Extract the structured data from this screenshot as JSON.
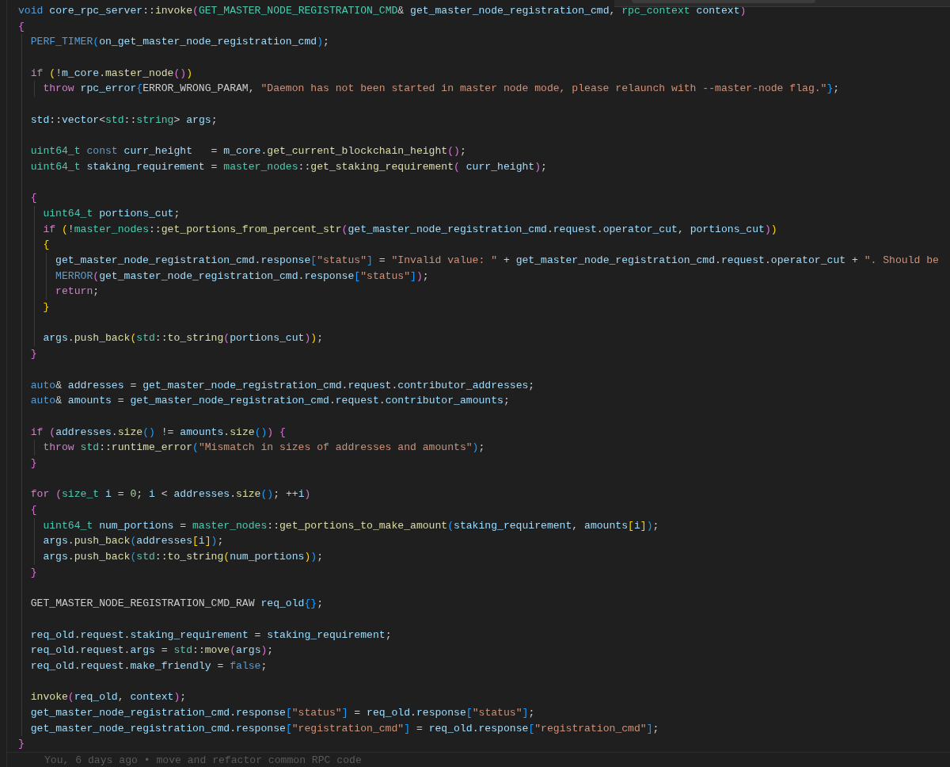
{
  "editor": {
    "lines": [
      {
        "kind": "code",
        "tokens": [
          {
            "kind": "st",
            "text": "void "
          },
          {
            "kind": "v",
            "text": "core_rpc_server"
          },
          {
            "kind": "p",
            "text": "::"
          },
          {
            "kind": "fn",
            "text": "invoke"
          },
          {
            "kind": "b2",
            "text": "("
          },
          {
            "kind": "ty",
            "text": "GET_MASTER_NODE_REGISTRATION_CMD"
          },
          {
            "kind": "p",
            "text": "& "
          },
          {
            "kind": "v",
            "text": "get_master_node_registration_cmd"
          },
          {
            "kind": "p",
            "text": ", "
          },
          {
            "kind": "ty",
            "text": "rpc_context "
          },
          {
            "kind": "v",
            "text": "context"
          },
          {
            "kind": "b2",
            "text": ")"
          }
        ]
      },
      {
        "kind": "code",
        "tokens": [
          {
            "kind": "b2",
            "text": "{"
          }
        ]
      },
      {
        "kind": "code",
        "tokens": [
          {
            "kind": "st",
            "text": "  PERF_TIMER"
          },
          {
            "kind": "b3",
            "text": "("
          },
          {
            "kind": "v",
            "text": "on_get_master_node_registration_cmd"
          },
          {
            "kind": "b3",
            "text": ")"
          },
          {
            "kind": "p",
            "text": ";"
          }
        ]
      },
      {
        "kind": "blank"
      },
      {
        "kind": "code",
        "tokens": [
          {
            "kind": "kw",
            "text": "  if "
          },
          {
            "kind": "b1",
            "text": "("
          },
          {
            "kind": "p",
            "text": "!"
          },
          {
            "kind": "v",
            "text": "m_core"
          },
          {
            "kind": "p",
            "text": "."
          },
          {
            "kind": "fn",
            "text": "master_node"
          },
          {
            "kind": "b2",
            "text": "()"
          },
          {
            "kind": "b1",
            "text": ")"
          }
        ]
      },
      {
        "kind": "code",
        "tokens": [
          {
            "kind": "kw",
            "text": "    throw "
          },
          {
            "kind": "v",
            "text": "rpc_error"
          },
          {
            "kind": "b3",
            "text": "{"
          },
          {
            "kind": "p",
            "text": "ERROR_WRONG_PARAM, "
          },
          {
            "kind": "s",
            "text": "\"Daemon has not been started in master node mode, please relaunch with --master-node flag.\""
          },
          {
            "kind": "b3",
            "text": "}"
          },
          {
            "kind": "p",
            "text": ";"
          }
        ]
      },
      {
        "kind": "blank"
      },
      {
        "kind": "code",
        "tokens": [
          {
            "kind": "v",
            "text": "  std"
          },
          {
            "kind": "p",
            "text": "::"
          },
          {
            "kind": "v",
            "text": "vector"
          },
          {
            "kind": "p",
            "text": "<"
          },
          {
            "kind": "ty",
            "text": "std"
          },
          {
            "kind": "p",
            "text": "::"
          },
          {
            "kind": "ty",
            "text": "string"
          },
          {
            "kind": "p",
            "text": "> "
          },
          {
            "kind": "v",
            "text": "args"
          },
          {
            "kind": "p",
            "text": ";"
          }
        ]
      },
      {
        "kind": "blank"
      },
      {
        "kind": "code",
        "tokens": [
          {
            "kind": "ty",
            "text": "  uint64_t "
          },
          {
            "kind": "st",
            "text": "const "
          },
          {
            "kind": "v",
            "text": "curr_height"
          },
          {
            "kind": "p",
            "text": "   = "
          },
          {
            "kind": "v",
            "text": "m_core"
          },
          {
            "kind": "p",
            "text": "."
          },
          {
            "kind": "fn",
            "text": "get_current_blockchain_height"
          },
          {
            "kind": "b2",
            "text": "()"
          },
          {
            "kind": "p",
            "text": ";"
          }
        ]
      },
      {
        "kind": "code",
        "tokens": [
          {
            "kind": "ty",
            "text": "  uint64_t "
          },
          {
            "kind": "v",
            "text": "staking_requirement"
          },
          {
            "kind": "p",
            "text": " = "
          },
          {
            "kind": "ty",
            "text": "master_nodes"
          },
          {
            "kind": "p",
            "text": "::"
          },
          {
            "kind": "fn",
            "text": "get_staking_requirement"
          },
          {
            "kind": "b2",
            "text": "( "
          },
          {
            "kind": "v",
            "text": "curr_height"
          },
          {
            "kind": "b2",
            "text": ")"
          },
          {
            "kind": "p",
            "text": ";"
          }
        ]
      },
      {
        "kind": "blank"
      },
      {
        "kind": "code",
        "tokens": [
          {
            "kind": "b2",
            "text": "  {"
          }
        ]
      },
      {
        "kind": "code",
        "tokens": [
          {
            "kind": "ty",
            "text": "    uint64_t "
          },
          {
            "kind": "v",
            "text": "portions_cut"
          },
          {
            "kind": "p",
            "text": ";"
          }
        ]
      },
      {
        "kind": "code",
        "tokens": [
          {
            "kind": "kw",
            "text": "    if "
          },
          {
            "kind": "b1",
            "text": "("
          },
          {
            "kind": "p",
            "text": "!"
          },
          {
            "kind": "ty",
            "text": "master_nodes"
          },
          {
            "kind": "p",
            "text": "::"
          },
          {
            "kind": "fn",
            "text": "get_portions_from_percent_str"
          },
          {
            "kind": "b2",
            "text": "("
          },
          {
            "kind": "v",
            "text": "get_master_node_registration_cmd"
          },
          {
            "kind": "p",
            "text": "."
          },
          {
            "kind": "v",
            "text": "request"
          },
          {
            "kind": "p",
            "text": "."
          },
          {
            "kind": "v",
            "text": "operator_cut"
          },
          {
            "kind": "p",
            "text": ", "
          },
          {
            "kind": "v",
            "text": "portions_cut"
          },
          {
            "kind": "b2",
            "text": ")"
          },
          {
            "kind": "b1",
            "text": ")"
          }
        ]
      },
      {
        "kind": "code",
        "tokens": [
          {
            "kind": "b1",
            "text": "    {"
          }
        ]
      },
      {
        "kind": "code",
        "tokens": [
          {
            "kind": "v",
            "text": "      get_master_node_registration_cmd"
          },
          {
            "kind": "p",
            "text": "."
          },
          {
            "kind": "v",
            "text": "response"
          },
          {
            "kind": "b3",
            "text": "["
          },
          {
            "kind": "s",
            "text": "\"status\""
          },
          {
            "kind": "b3",
            "text": "]"
          },
          {
            "kind": "p",
            "text": " = "
          },
          {
            "kind": "s",
            "text": "\"Invalid value: \""
          },
          {
            "kind": "p",
            "text": " + "
          },
          {
            "kind": "v",
            "text": "get_master_node_registration_cmd"
          },
          {
            "kind": "p",
            "text": "."
          },
          {
            "kind": "v",
            "text": "request"
          },
          {
            "kind": "p",
            "text": "."
          },
          {
            "kind": "v",
            "text": "operator_cut"
          },
          {
            "kind": "p",
            "text": " + "
          },
          {
            "kind": "s",
            "text": "\". Should be"
          }
        ]
      },
      {
        "kind": "code",
        "tokens": [
          {
            "kind": "st",
            "text": "      MERROR"
          },
          {
            "kind": "b2",
            "text": "("
          },
          {
            "kind": "v",
            "text": "get_master_node_registration_cmd"
          },
          {
            "kind": "p",
            "text": "."
          },
          {
            "kind": "v",
            "text": "response"
          },
          {
            "kind": "b3",
            "text": "["
          },
          {
            "kind": "s",
            "text": "\"status\""
          },
          {
            "kind": "b3",
            "text": "]"
          },
          {
            "kind": "b2",
            "text": ")"
          },
          {
            "kind": "p",
            "text": ";"
          }
        ]
      },
      {
        "kind": "code",
        "tokens": [
          {
            "kind": "kw",
            "text": "      return"
          },
          {
            "kind": "p",
            "text": ";"
          }
        ]
      },
      {
        "kind": "code",
        "tokens": [
          {
            "kind": "b1",
            "text": "    }"
          }
        ]
      },
      {
        "kind": "blank"
      },
      {
        "kind": "code",
        "tokens": [
          {
            "kind": "v",
            "text": "    args"
          },
          {
            "kind": "p",
            "text": "."
          },
          {
            "kind": "fn",
            "text": "push_back"
          },
          {
            "kind": "b1",
            "text": "("
          },
          {
            "kind": "ty",
            "text": "std"
          },
          {
            "kind": "p",
            "text": "::"
          },
          {
            "kind": "fn",
            "text": "to_string"
          },
          {
            "kind": "b2",
            "text": "("
          },
          {
            "kind": "v",
            "text": "portions_cut"
          },
          {
            "kind": "b2",
            "text": ")"
          },
          {
            "kind": "b1",
            "text": ")"
          },
          {
            "kind": "p",
            "text": ";"
          }
        ]
      },
      {
        "kind": "code",
        "tokens": [
          {
            "kind": "b2",
            "text": "  }"
          }
        ]
      },
      {
        "kind": "blank"
      },
      {
        "kind": "code",
        "tokens": [
          {
            "kind": "st",
            "text": "  auto"
          },
          {
            "kind": "p",
            "text": "& "
          },
          {
            "kind": "v",
            "text": "addresses"
          },
          {
            "kind": "p",
            "text": " = "
          },
          {
            "kind": "v",
            "text": "get_master_node_registration_cmd"
          },
          {
            "kind": "p",
            "text": "."
          },
          {
            "kind": "v",
            "text": "request"
          },
          {
            "kind": "p",
            "text": "."
          },
          {
            "kind": "v",
            "text": "contributor_addresses"
          },
          {
            "kind": "p",
            "text": ";"
          }
        ]
      },
      {
        "kind": "code",
        "tokens": [
          {
            "kind": "st",
            "text": "  auto"
          },
          {
            "kind": "p",
            "text": "& "
          },
          {
            "kind": "v",
            "text": "amounts"
          },
          {
            "kind": "p",
            "text": " = "
          },
          {
            "kind": "v",
            "text": "get_master_node_registration_cmd"
          },
          {
            "kind": "p",
            "text": "."
          },
          {
            "kind": "v",
            "text": "request"
          },
          {
            "kind": "p",
            "text": "."
          },
          {
            "kind": "v",
            "text": "contributor_amounts"
          },
          {
            "kind": "p",
            "text": ";"
          }
        ]
      },
      {
        "kind": "blank"
      },
      {
        "kind": "code",
        "tokens": [
          {
            "kind": "kw",
            "text": "  if "
          },
          {
            "kind": "b2",
            "text": "("
          },
          {
            "kind": "v",
            "text": "addresses"
          },
          {
            "kind": "p",
            "text": "."
          },
          {
            "kind": "fn",
            "text": "size"
          },
          {
            "kind": "b3",
            "text": "()"
          },
          {
            "kind": "p",
            "text": " != "
          },
          {
            "kind": "v",
            "text": "amounts"
          },
          {
            "kind": "p",
            "text": "."
          },
          {
            "kind": "fn",
            "text": "size"
          },
          {
            "kind": "b3",
            "text": "()"
          },
          {
            "kind": "b2",
            "text": ")"
          },
          {
            "kind": "b2",
            "text": " {"
          }
        ]
      },
      {
        "kind": "code",
        "tokens": [
          {
            "kind": "kw",
            "text": "    throw "
          },
          {
            "kind": "ty",
            "text": "std"
          },
          {
            "kind": "p",
            "text": "::"
          },
          {
            "kind": "fn",
            "text": "runtime_error"
          },
          {
            "kind": "b3",
            "text": "("
          },
          {
            "kind": "s",
            "text": "\"Mismatch in sizes of addresses and amounts\""
          },
          {
            "kind": "b3",
            "text": ")"
          },
          {
            "kind": "p",
            "text": ";"
          }
        ]
      },
      {
        "kind": "code",
        "tokens": [
          {
            "kind": "b2",
            "text": "  }"
          }
        ]
      },
      {
        "kind": "blank"
      },
      {
        "kind": "code",
        "tokens": [
          {
            "kind": "kw",
            "text": "  for "
          },
          {
            "kind": "b2",
            "text": "("
          },
          {
            "kind": "ty",
            "text": "size_t "
          },
          {
            "kind": "v",
            "text": "i"
          },
          {
            "kind": "p",
            "text": " = "
          },
          {
            "kind": "n",
            "text": "0"
          },
          {
            "kind": "p",
            "text": "; "
          },
          {
            "kind": "v",
            "text": "i"
          },
          {
            "kind": "p",
            "text": " < "
          },
          {
            "kind": "v",
            "text": "addresses"
          },
          {
            "kind": "p",
            "text": "."
          },
          {
            "kind": "fn",
            "text": "size"
          },
          {
            "kind": "b3",
            "text": "()"
          },
          {
            "kind": "p",
            "text": "; ++"
          },
          {
            "kind": "v",
            "text": "i"
          },
          {
            "kind": "b2",
            "text": ")"
          }
        ]
      },
      {
        "kind": "code",
        "tokens": [
          {
            "kind": "b2",
            "text": "  {"
          }
        ]
      },
      {
        "kind": "code",
        "tokens": [
          {
            "kind": "ty",
            "text": "    uint64_t "
          },
          {
            "kind": "v",
            "text": "num_portions"
          },
          {
            "kind": "p",
            "text": " = "
          },
          {
            "kind": "ty",
            "text": "master_nodes"
          },
          {
            "kind": "p",
            "text": "::"
          },
          {
            "kind": "fn",
            "text": "get_portions_to_make_amount"
          },
          {
            "kind": "b3",
            "text": "("
          },
          {
            "kind": "v",
            "text": "staking_requirement"
          },
          {
            "kind": "p",
            "text": ", "
          },
          {
            "kind": "v",
            "text": "amounts"
          },
          {
            "kind": "b1",
            "text": "["
          },
          {
            "kind": "v",
            "text": "i"
          },
          {
            "kind": "b1",
            "text": "]"
          },
          {
            "kind": "b3",
            "text": ")"
          },
          {
            "kind": "p",
            "text": ";"
          }
        ]
      },
      {
        "kind": "code",
        "tokens": [
          {
            "kind": "v",
            "text": "    args"
          },
          {
            "kind": "p",
            "text": "."
          },
          {
            "kind": "fn",
            "text": "push_back"
          },
          {
            "kind": "b3",
            "text": "("
          },
          {
            "kind": "v",
            "text": "addresses"
          },
          {
            "kind": "b1",
            "text": "["
          },
          {
            "kind": "v",
            "text": "i"
          },
          {
            "kind": "b1",
            "text": "]"
          },
          {
            "kind": "b3",
            "text": ")"
          },
          {
            "kind": "p",
            "text": ";"
          }
        ]
      },
      {
        "kind": "code",
        "tokens": [
          {
            "kind": "v",
            "text": "    args"
          },
          {
            "kind": "p",
            "text": "."
          },
          {
            "kind": "fn",
            "text": "push_back"
          },
          {
            "kind": "b3",
            "text": "("
          },
          {
            "kind": "ty",
            "text": "std"
          },
          {
            "kind": "p",
            "text": "::"
          },
          {
            "kind": "fn",
            "text": "to_string"
          },
          {
            "kind": "b1",
            "text": "("
          },
          {
            "kind": "v",
            "text": "num_portions"
          },
          {
            "kind": "b1",
            "text": ")"
          },
          {
            "kind": "b3",
            "text": ")"
          },
          {
            "kind": "p",
            "text": ";"
          }
        ]
      },
      {
        "kind": "code",
        "tokens": [
          {
            "kind": "b2",
            "text": "  }"
          }
        ]
      },
      {
        "kind": "blank"
      },
      {
        "kind": "code",
        "tokens": [
          {
            "kind": "p",
            "text": "  GET_MASTER_NODE_REGISTRATION_CMD_RAW "
          },
          {
            "kind": "v",
            "text": "req_old"
          },
          {
            "kind": "b3",
            "text": "{}"
          },
          {
            "kind": "p",
            "text": ";"
          }
        ]
      },
      {
        "kind": "blank"
      },
      {
        "kind": "code",
        "tokens": [
          {
            "kind": "v",
            "text": "  req_old"
          },
          {
            "kind": "p",
            "text": "."
          },
          {
            "kind": "v",
            "text": "request"
          },
          {
            "kind": "p",
            "text": "."
          },
          {
            "kind": "v",
            "text": "staking_requirement"
          },
          {
            "kind": "p",
            "text": " = "
          },
          {
            "kind": "v",
            "text": "staking_requirement"
          },
          {
            "kind": "p",
            "text": ";"
          }
        ]
      },
      {
        "kind": "code",
        "tokens": [
          {
            "kind": "v",
            "text": "  req_old"
          },
          {
            "kind": "p",
            "text": "."
          },
          {
            "kind": "v",
            "text": "request"
          },
          {
            "kind": "p",
            "text": "."
          },
          {
            "kind": "v",
            "text": "args"
          },
          {
            "kind": "p",
            "text": " = "
          },
          {
            "kind": "ty",
            "text": "std"
          },
          {
            "kind": "p",
            "text": "::"
          },
          {
            "kind": "fn",
            "text": "move"
          },
          {
            "kind": "b2",
            "text": "("
          },
          {
            "kind": "v",
            "text": "args"
          },
          {
            "kind": "b2",
            "text": ")"
          },
          {
            "kind": "p",
            "text": ";"
          }
        ]
      },
      {
        "kind": "code",
        "tokens": [
          {
            "kind": "v",
            "text": "  req_old"
          },
          {
            "kind": "p",
            "text": "."
          },
          {
            "kind": "v",
            "text": "request"
          },
          {
            "kind": "p",
            "text": "."
          },
          {
            "kind": "v",
            "text": "make_friendly"
          },
          {
            "kind": "p",
            "text": " = "
          },
          {
            "kind": "st",
            "text": "false"
          },
          {
            "kind": "p",
            "text": ";"
          }
        ]
      },
      {
        "kind": "blank"
      },
      {
        "kind": "code",
        "tokens": [
          {
            "kind": "fn",
            "text": "  invoke"
          },
          {
            "kind": "b2",
            "text": "("
          },
          {
            "kind": "v",
            "text": "req_old"
          },
          {
            "kind": "p",
            "text": ", "
          },
          {
            "kind": "v",
            "text": "context"
          },
          {
            "kind": "b2",
            "text": ")"
          },
          {
            "kind": "p",
            "text": ";"
          }
        ]
      },
      {
        "kind": "code",
        "tokens": [
          {
            "kind": "v",
            "text": "  get_master_node_registration_cmd"
          },
          {
            "kind": "p",
            "text": "."
          },
          {
            "kind": "v",
            "text": "response"
          },
          {
            "kind": "b3",
            "text": "["
          },
          {
            "kind": "s",
            "text": "\"status\""
          },
          {
            "kind": "b3",
            "text": "]"
          },
          {
            "kind": "p",
            "text": " = "
          },
          {
            "kind": "v",
            "text": "req_old"
          },
          {
            "kind": "p",
            "text": "."
          },
          {
            "kind": "v",
            "text": "response"
          },
          {
            "kind": "b3",
            "text": "["
          },
          {
            "kind": "s",
            "text": "\"status\""
          },
          {
            "kind": "b3",
            "text": "]"
          },
          {
            "kind": "p",
            "text": ";"
          }
        ]
      },
      {
        "kind": "code",
        "tokens": [
          {
            "kind": "v",
            "text": "  get_master_node_registration_cmd"
          },
          {
            "kind": "p",
            "text": "."
          },
          {
            "kind": "v",
            "text": "response"
          },
          {
            "kind": "b3",
            "text": "["
          },
          {
            "kind": "s",
            "text": "\"registration_cmd\""
          },
          {
            "kind": "b3",
            "text": "]"
          },
          {
            "kind": "p",
            "text": " = "
          },
          {
            "kind": "v",
            "text": "req_old"
          },
          {
            "kind": "p",
            "text": "."
          },
          {
            "kind": "v",
            "text": "response"
          },
          {
            "kind": "b3",
            "text": "["
          },
          {
            "kind": "s",
            "text": "\"registration_cmd\""
          },
          {
            "kind": "b3",
            "text": "]"
          },
          {
            "kind": "p",
            "text": ";"
          }
        ]
      },
      {
        "kind": "code",
        "tokens": [
          {
            "kind": "b2",
            "text": "}"
          }
        ]
      }
    ],
    "blame": {
      "text": "You, 6 days ago • move and refactor common RPC code"
    }
  }
}
